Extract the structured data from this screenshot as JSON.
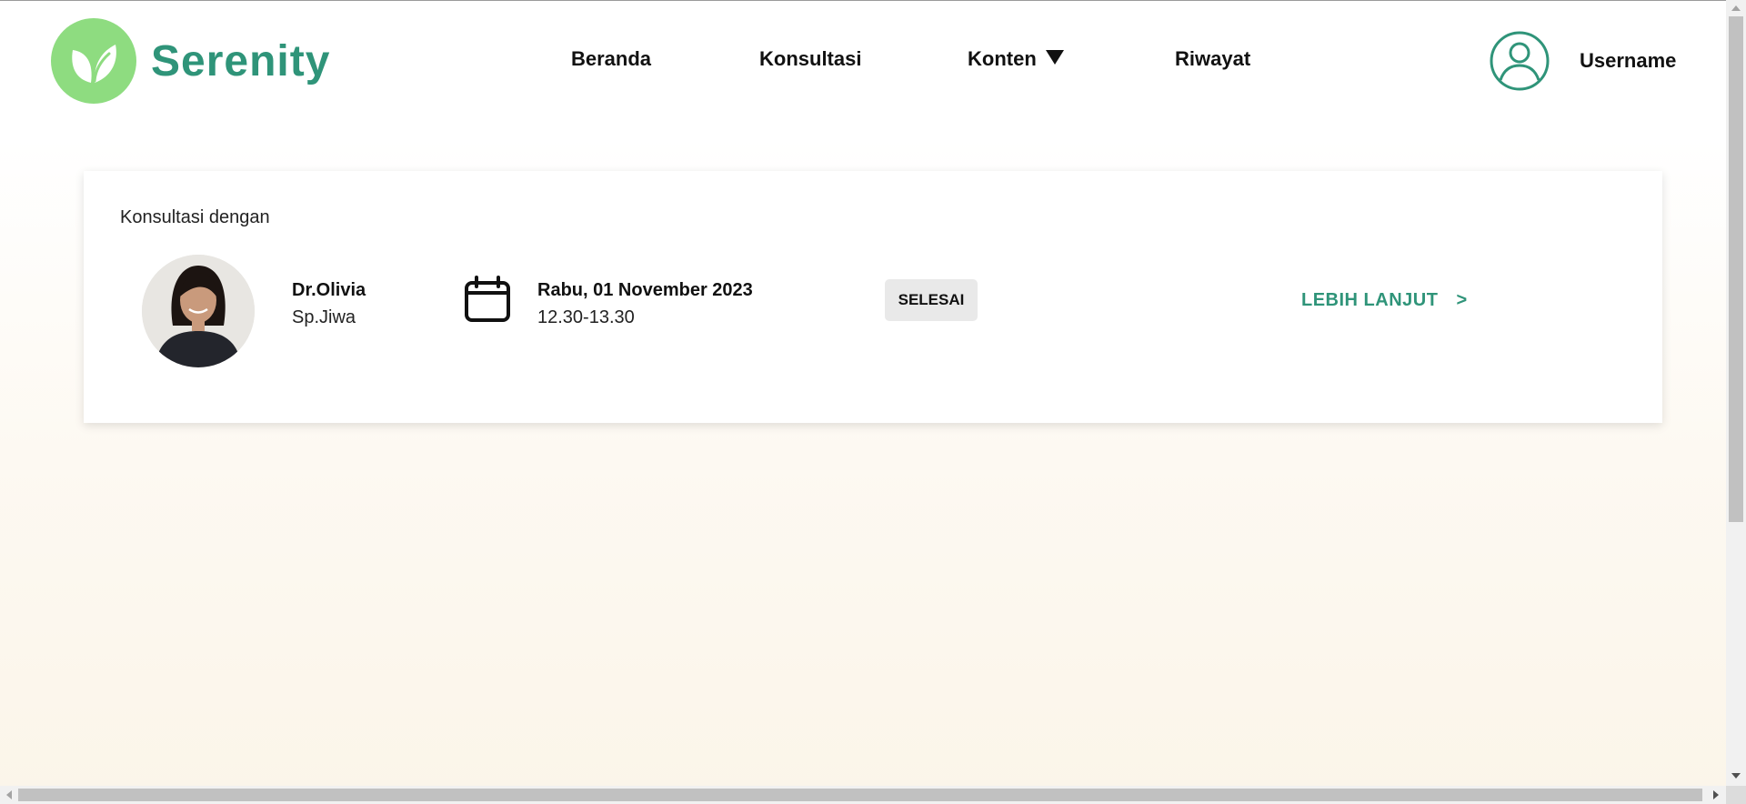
{
  "brand": {
    "name": "Serenity",
    "colors": {
      "primary": "#2f9479",
      "logo_circle": "#8edc80",
      "badge_bg": "#e9e9e9"
    }
  },
  "nav": {
    "items": [
      {
        "label": "Beranda"
      },
      {
        "label": "Konsultasi"
      },
      {
        "label": "Konten",
        "icon": "caret-down-icon"
      },
      {
        "label": "Riwayat"
      }
    ]
  },
  "user": {
    "icon": "user-circle-icon",
    "name": "Username"
  },
  "consultation": {
    "heading": "Konsultasi dengan",
    "doctor_name": "Dr.Olivia",
    "doctor_specialty": "Sp.Jiwa",
    "date_icon": "calendar-icon",
    "date": "Rabu, 01 November 2023",
    "time": "12.30-13.30",
    "status": "SELESAI",
    "more_label": "LEBIH LANJUT",
    "more_arrow": ">"
  }
}
